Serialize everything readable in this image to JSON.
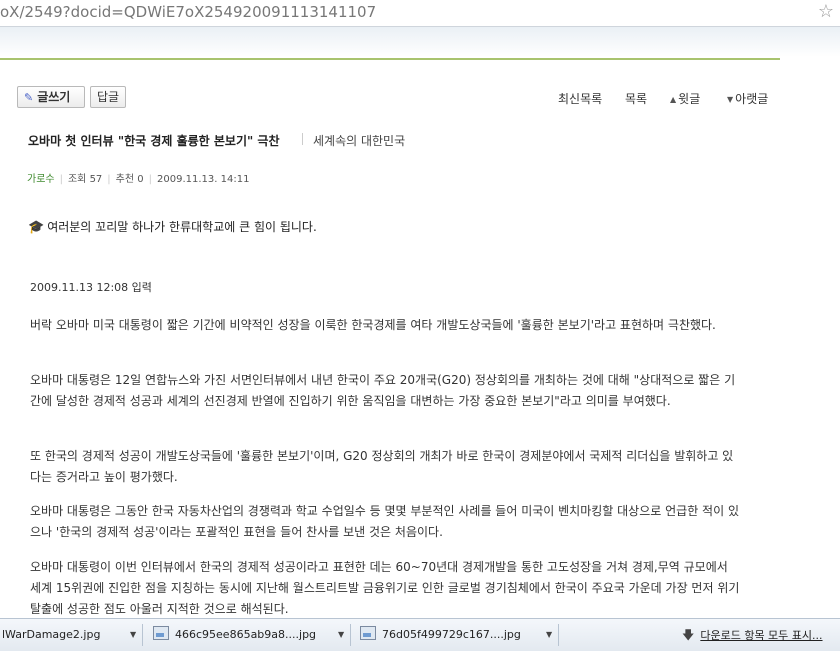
{
  "browser": {
    "url": "oX/2549?docid=QDWiE7oX254920091113141107",
    "bookmark_star": "☆"
  },
  "toolbar": {
    "write_label": "글쓰기",
    "reply_label": "답글",
    "latest_label": "최신목록",
    "list_label": "목록",
    "prev_label": "윗글",
    "next_label": "아랫글"
  },
  "post": {
    "title": "오바마 첫 인터뷰 \"한국 경제 훌륭한 본보기\" 극찬",
    "category": "세계속의 대한민국",
    "author": "가로수",
    "views": "조회 57",
    "recommends": "추천 0",
    "datetime": "2009.11.13. 14:11",
    "notice": "여러분의 꼬리말 하나가 한류대학교에 큰 힘이 됩니다.",
    "dateline": "2009.11.13 12:08 입력",
    "paragraphs": [
      "버락 오바마 미국 대통령이 짧은 기간에 비약적인 성장을 이룩한 한국경제를 여타 개발도상국들에 '훌륭한 본보기'라고 표현하며 극찬했다.",
      "오바마 대통령은 12일 연합뉴스와 가진 서면인터뷰에서 내년 한국이 주요 20개국(G20) 정상회의를 개최하는 것에 대해 \"상대적으로 짧은 기간에 달성한 경제적 성공과 세계의 선진경제 반열에 진입하기 위한 움직임을 대변하는 가장 중요한 본보기\"라고 의미를 부여했다.",
      "또 한국의 경제적 성공이 개발도상국들에 '훌륭한 본보기'이며, G20 정상회의 개최가 바로 한국이 경제분야에서 국제적 리더십을 발휘하고 있다는 증거라고 높이 평가했다.",
      "오바마 대통령은 그동안 한국 자동차산업의 경쟁력과 학교 수업일수 등 몇몇 부분적인 사례를 들어 미국이 벤치마킹할 대상으로 언급한 적이 있으나 '한국의 경제적 성공'이라는 포괄적인 표현을 들어 찬사를 보낸 것은 처음이다.",
      "오바마 대통령이 이번 인터뷰에서 한국의 경제적 성공이라고 표현한 데는 60~70년대 경제개발을 통한 고도성장을 거쳐 경제,무역 규모에서 세계 15위권에 진입한 점을 지칭하는 동시에 지난해 월스트리트발 금융위기로 인한 글로벌 경기침체에서 한국이 주요국 가운데 가장 먼저 위기탈출에 성공한 점도 아울러 지적한 것으로 해석된다."
    ]
  },
  "downloads": {
    "items": [
      {
        "name": "lWarDamage2.jpg"
      },
      {
        "name": "466c95ee865ab9a8....jpg"
      },
      {
        "name": "76d05f499729c167....jpg"
      }
    ],
    "show_all": "다운로드 항목 모두 표시..."
  }
}
